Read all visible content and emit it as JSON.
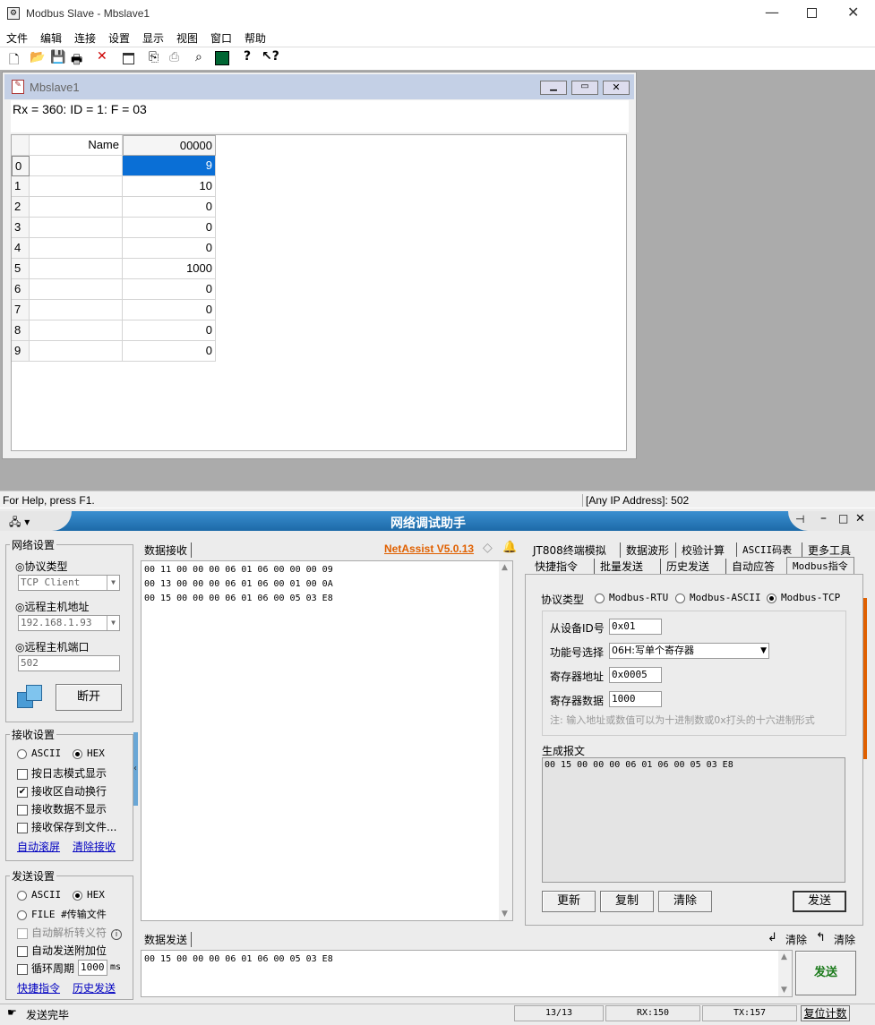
{
  "mbslave": {
    "title": "Modbus Slave - Mbslave1",
    "menu": [
      "文件",
      "编辑",
      "连接",
      "设置",
      "显示",
      "视图",
      "窗口",
      "帮助"
    ],
    "child_title": "Mbslave1",
    "status_line": "Rx = 360: ID = 1: F = 03",
    "grid": {
      "col_name": "Name",
      "col_addr": "00000",
      "rows": [
        {
          "idx": "0",
          "val": "9"
        },
        {
          "idx": "1",
          "val": "10"
        },
        {
          "idx": "2",
          "val": "0"
        },
        {
          "idx": "3",
          "val": "0"
        },
        {
          "idx": "4",
          "val": "0"
        },
        {
          "idx": "5",
          "val": "1000"
        },
        {
          "idx": "6",
          "val": "0"
        },
        {
          "idx": "7",
          "val": "0"
        },
        {
          "idx": "8",
          "val": "0"
        },
        {
          "idx": "9",
          "val": "0"
        }
      ]
    },
    "statusbar_left": "For Help, press F1.",
    "statusbar_right": "[Any IP Address]: 502"
  },
  "netassist": {
    "title": "网络调试助手",
    "version": "NetAssist V5.0.13",
    "net_settings": {
      "group": "网络设置",
      "proto_label": "◎协议类型",
      "proto_value": "TCP Client",
      "host_label": "◎远程主机地址",
      "host_value": "192.168.1.93",
      "port_label": "◎远程主机端口",
      "port_value": "502",
      "disconnect": "断开"
    },
    "recv_settings": {
      "group": "接收设置",
      "ascii": "ASCII",
      "hex": "HEX",
      "opt1": "按日志模式显示",
      "opt2": "接收区自动换行",
      "opt3": "接收数据不显示",
      "opt4": "接收保存到文件...",
      "link1": "自动滚屏",
      "link2": "清除接收"
    },
    "send_settings": {
      "group": "发送设置",
      "ascii": "ASCII",
      "hex": "HEX",
      "file": "FILE #传输文件",
      "opt1": "自动解析转义符",
      "opt2": "自动发送附加位",
      "opt3": "循环周期",
      "period": "1000",
      "ms": "ms",
      "link1": "快捷指令",
      "link2": "历史发送"
    },
    "recv_tab": "数据接收",
    "recv_lines": [
      "00 11 00 00 00 06 01 06 00 00 00 09",
      "00 13 00 00 00 06 01 06 00 01 00 0A",
      "00 15 00 00 00 06 01 06 00 05 03 E8"
    ],
    "tabs_row1": [
      "JT808终端模拟",
      "数据波形",
      "校验计算",
      "ASCII码表",
      "更多工具"
    ],
    "tabs_row2": [
      "快捷指令",
      "批量发送",
      "历史发送",
      "自动应答",
      "Modbus指令"
    ],
    "modbus": {
      "proto_label": "协议类型",
      "rtu": "Modbus-RTU",
      "ascii": "Modbus-ASCII",
      "tcp": "Modbus-TCP",
      "dev_label": "从设备ID号",
      "dev_value": "0x01",
      "func_label": "功能号选择",
      "func_value": "06H:写单个寄存器",
      "addr_label": "寄存器地址",
      "addr_value": "0x0005",
      "data_label": "寄存器数据",
      "data_value": "1000",
      "note": "注: 输入地址或数值可以为十进制数或0x打头的十六进制形式",
      "gen_label": "生成报文",
      "gen_value": "00 15 00 00 00 06 01 06 00 05 03 E8",
      "btn_update": "更新",
      "btn_copy": "复制",
      "btn_clear": "清除",
      "btn_send": "发送"
    },
    "send_tab": "数据发送",
    "clear1": "清除",
    "clear2": "清除",
    "send_text": "00 15 00 00 00 06 01 06 00 05 03 E8",
    "send_btn": "发送",
    "status": {
      "text": "发送完毕",
      "count": "13/13",
      "rx": "RX:150",
      "tx": "TX:157",
      "reset": "复位计数"
    }
  }
}
